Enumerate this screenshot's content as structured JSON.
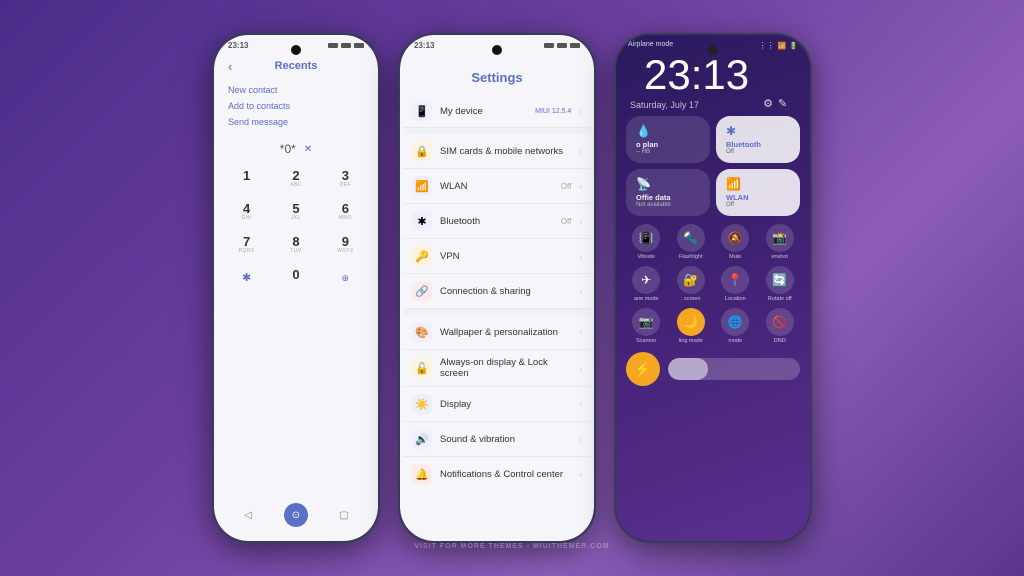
{
  "global": {
    "time": "23:13",
    "watermark": "VISIT FOR MORE THEMES - MIUITHEMER.COM"
  },
  "left_phone": {
    "title": "Recents",
    "links": [
      "New contact",
      "Add to contacts",
      "Send message"
    ],
    "dialpad_display": "*0*",
    "keys": [
      {
        "num": "1",
        "sub": ""
      },
      {
        "num": "2",
        "sub": "ABC"
      },
      {
        "num": "3",
        "sub": "DEF"
      },
      {
        "num": "4",
        "sub": "GHI"
      },
      {
        "num": "5",
        "sub": "JKL"
      },
      {
        "num": "6",
        "sub": "MNO"
      },
      {
        "num": "7",
        "sub": "PQRS"
      },
      {
        "num": "8",
        "sub": "TUV"
      },
      {
        "num": "9",
        "sub": "WXYZ"
      }
    ],
    "bottom_nav": [
      "back",
      "home",
      "recent"
    ]
  },
  "mid_phone": {
    "header": "Settings",
    "items": [
      {
        "icon": "📱",
        "label": "My device",
        "value": "MIUI 12.5.4",
        "color": "#5b6fc8"
      },
      {
        "icon": "🔒",
        "label": "SIM cards & mobile networks",
        "value": "",
        "color": "#f5a623"
      },
      {
        "icon": "📶",
        "label": "WLAN",
        "value": "Off",
        "color": "#5b6fc8"
      },
      {
        "icon": "✱",
        "label": "Bluetooth",
        "value": "Off",
        "color": "#5b6fc8"
      },
      {
        "icon": "🔑",
        "label": "VPN",
        "value": "",
        "color": "#f5a623"
      },
      {
        "icon": "🔗",
        "label": "Connection & sharing",
        "value": "",
        "color": "#e06060"
      },
      {
        "icon": "🎨",
        "label": "Wallpaper & personalization",
        "value": "",
        "color": "#5b6fc8"
      },
      {
        "icon": "🔓",
        "label": "Always-on display & Lock screen",
        "value": "",
        "color": "#f5a623"
      },
      {
        "icon": "☀️",
        "label": "Display",
        "value": "",
        "color": "#5588ee"
      },
      {
        "icon": "🔊",
        "label": "Sound & vibration",
        "value": "",
        "color": "#5b6fc8"
      },
      {
        "icon": "🔔",
        "label": "Notifications & Control center",
        "value": "",
        "color": "#e06060"
      }
    ]
  },
  "right_phone": {
    "top_label": "Airplane mode",
    "time": "23:13",
    "date": "Saturday, July 17",
    "tiles": [
      {
        "label": "o plan",
        "sub": "-- HB",
        "icon": "💧",
        "active": false
      },
      {
        "label": "Bluetooth",
        "sub": "Off",
        "icon": "🔵",
        "active": true
      },
      {
        "label": "Offie data",
        "sub": "Not available",
        "icon": "📡",
        "active": false
      },
      {
        "label": "WLAN",
        "sub": "Off",
        "icon": "📶",
        "active": true
      }
    ],
    "icon_rows": [
      [
        {
          "icon": "📳",
          "label": "Vibrate"
        },
        {
          "icon": "🔦",
          "label": "Flashlight"
        },
        {
          "icon": "🔕",
          "label": "Mute"
        },
        {
          "icon": "📸",
          "label": "enshot"
        }
      ],
      [
        {
          "icon": "✈️",
          "label": "ane mode"
        },
        {
          "icon": "🔐",
          "label": ": screen"
        },
        {
          "icon": "📍",
          "label": "Location"
        },
        {
          "icon": "🔄",
          "label": "Rotate off"
        }
      ],
      [
        {
          "icon": "📷",
          "label": "Scanner"
        },
        {
          "icon": "🌙",
          "label": "ling mode",
          "orange": true
        },
        {
          "icon": "🌐",
          "label": "mode"
        },
        {
          "icon": "🚫",
          "label": "DND"
        }
      ]
    ]
  }
}
